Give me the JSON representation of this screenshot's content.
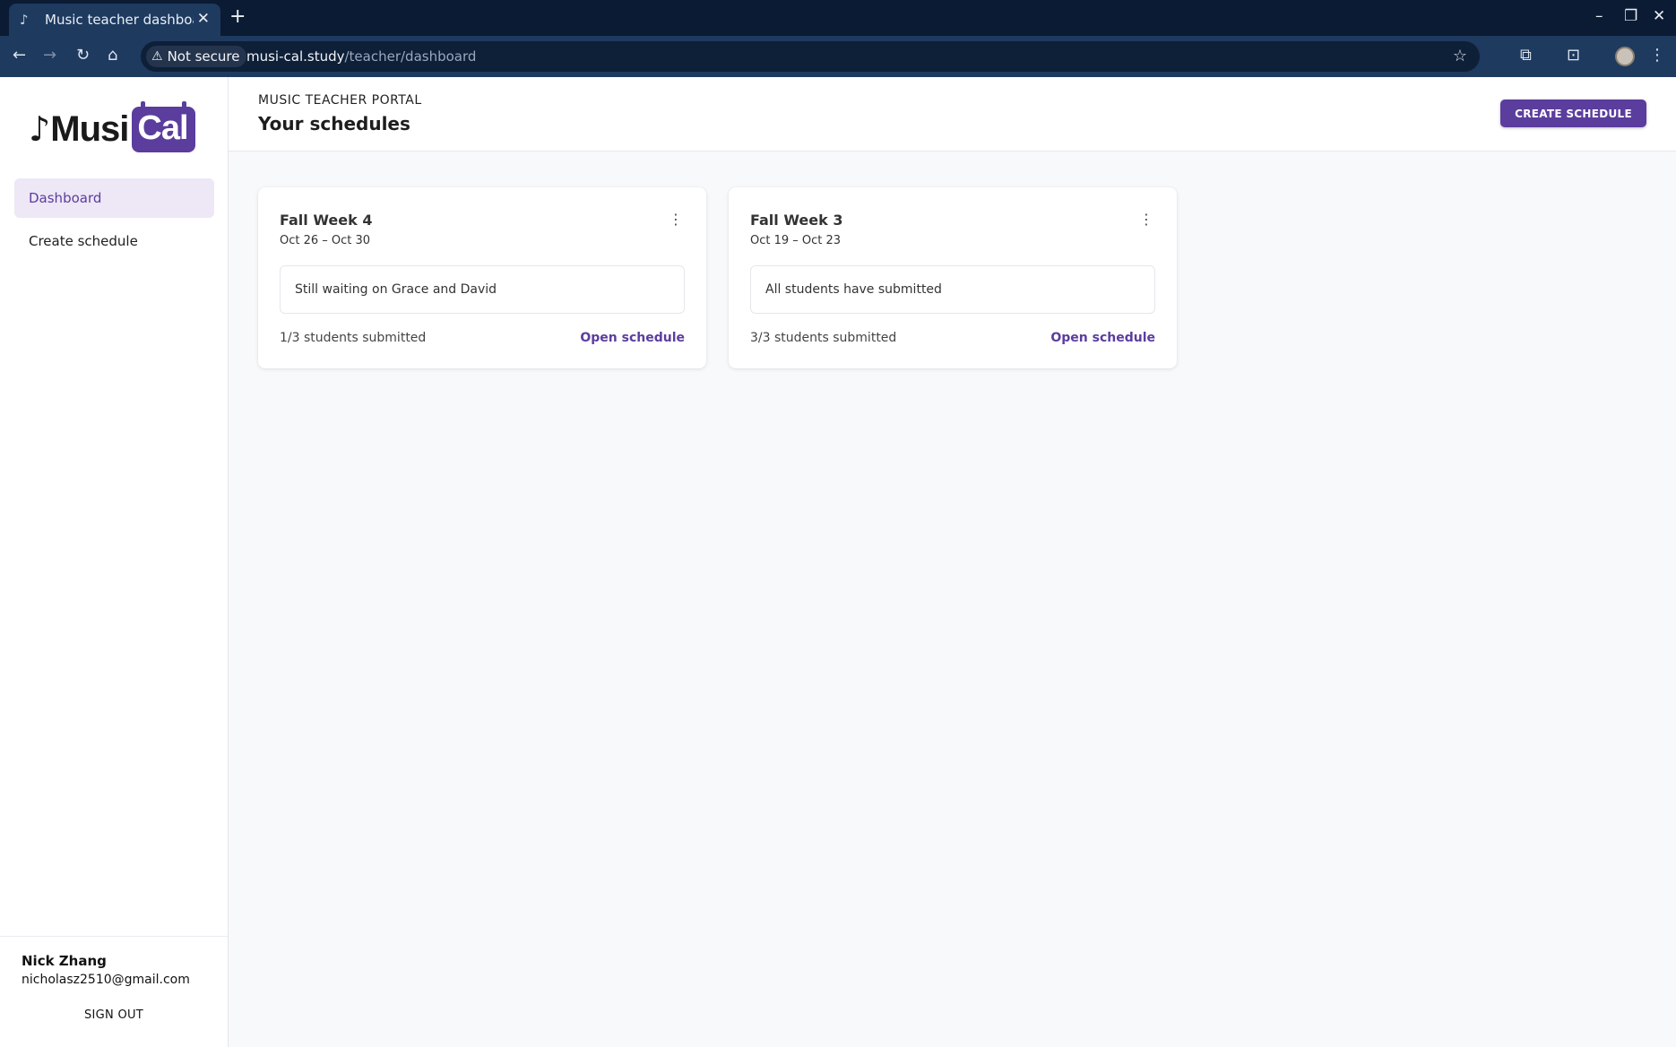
{
  "browser": {
    "tab_title": "Music teacher dashboard",
    "security_label": "Not secure",
    "url_host": "musi-cal.study",
    "url_path": "/teacher/dashboard"
  },
  "sidebar": {
    "logo_text_musi": "Musi",
    "logo_text_cal": "Cal",
    "items": [
      {
        "label": "Dashboard",
        "active": true
      },
      {
        "label": "Create schedule",
        "active": false
      }
    ],
    "user": {
      "name": "Nick Zhang",
      "email": "nicholasz2510@gmail.com",
      "sign_out_label": "SIGN OUT"
    }
  },
  "header": {
    "eyebrow": "MUSIC TEACHER PORTAL",
    "title": "Your schedules",
    "create_button_label": "CREATE SCHEDULE"
  },
  "schedules": [
    {
      "title": "Fall Week 4",
      "dates": "Oct 26 – Oct 30",
      "note": "Still waiting on Grace and David",
      "submitted": "1/3 students submitted",
      "link_label": "Open schedule"
    },
    {
      "title": "Fall Week 3",
      "dates": "Oct 19 – Oct 23",
      "note": "All students have submitted",
      "submitted": "3/3 students submitted",
      "link_label": "Open schedule"
    }
  ],
  "colors": {
    "accent": "#5b3d9e",
    "active_nav_bg": "#ede7f6",
    "browser_frame": "#0b1b33"
  },
  "icons": {
    "tab_favicon": "music-note-icon",
    "tab_close": "close-icon",
    "new_tab": "plus-icon",
    "back": "arrow-left-icon",
    "forward": "arrow-right-icon",
    "reload": "reload-icon",
    "home": "home-icon",
    "warning": "warning-icon",
    "bookmark": "star-icon",
    "extensions": "puzzle-icon",
    "kebab": "more-vertical-icon"
  }
}
